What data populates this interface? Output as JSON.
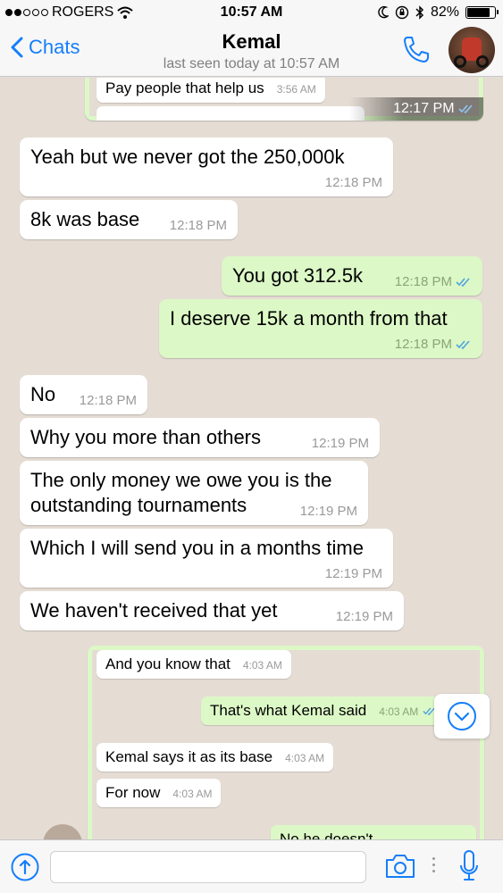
{
  "status_bar": {
    "carrier": "ROGERS",
    "time": "10:57 AM",
    "battery": "82%",
    "battery_level": 0.82
  },
  "header": {
    "back_label": "Chats",
    "contact_name": "Kemal",
    "last_seen": "last seen today at 10:57 AM"
  },
  "screenshot_top": {
    "message": "Pay people that help us",
    "message_time": "3:56 AM",
    "overlay_time": "12:17 PM"
  },
  "messages": [
    {
      "dir": "in",
      "text": "Yeah but we never got the 250,000k",
      "time": "12:18 PM"
    },
    {
      "dir": "in",
      "text": "8k was base",
      "time": "12:18 PM"
    },
    {
      "dir": "out",
      "text": "You got 312.5k",
      "time": "12:18 PM"
    },
    {
      "dir": "out",
      "text": "I deserve 15k a month from that",
      "time": "12:18 PM"
    },
    {
      "dir": "in",
      "text": "No",
      "time": "12:18 PM"
    },
    {
      "dir": "in",
      "text": "Why you more than others",
      "time": "12:19 PM"
    },
    {
      "dir": "in",
      "text_line1": "The only money we owe you is the",
      "text_line2": "outstanding tournaments",
      "time": "12:19 PM"
    },
    {
      "dir": "in",
      "text": "Which I will send you in a months time",
      "time": "12:19 PM"
    },
    {
      "dir": "in",
      "text": "We haven't received that yet",
      "time": "12:19 PM"
    }
  ],
  "screenshot_bottom": {
    "items": [
      {
        "dir": "in",
        "text": "And you know that",
        "time": "4:03 AM"
      },
      {
        "dir": "out",
        "text": "That's what Kemal said",
        "time": "4:03 AM"
      },
      {
        "dir": "in",
        "text": "Kemal says it as its base",
        "time": "4:03 AM"
      },
      {
        "dir": "in",
        "text": "For now",
        "time": "4:03 AM"
      },
      {
        "dir": "out",
        "text": "No he doesn't"
      }
    ]
  },
  "input": {
    "placeholder": ""
  },
  "colors": {
    "accent": "#157efb",
    "chat_background": "#e5ddd4",
    "outgoing_bubble": "#dcf8c6",
    "incoming_bubble": "#ffffff",
    "read_tick": "#4fa3e0"
  },
  "icons": [
    "wifi-icon",
    "moon-icon",
    "lock-rotation-icon",
    "bluetooth-icon",
    "battery-icon",
    "back-chevron-icon",
    "phone-icon",
    "plus-circle-icon",
    "camera-icon",
    "microphone-icon",
    "scroll-down-icon",
    "double-check-icon"
  ]
}
